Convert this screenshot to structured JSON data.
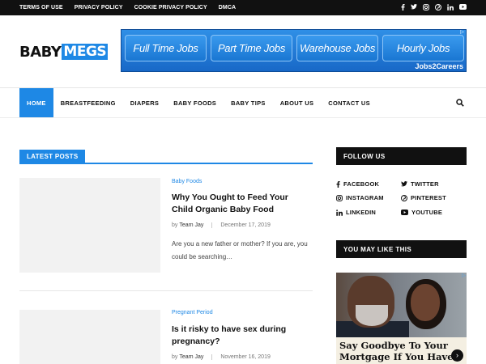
{
  "topbar": {
    "links": [
      "TERMS OF USE",
      "PRIVACY POLICY",
      "COOKIE PRIVACY POLICY",
      "DMCA"
    ],
    "social_icons": [
      "facebook-icon",
      "twitter-icon",
      "instagram-icon",
      "pinterest-icon",
      "linkedin-icon",
      "youtube-icon"
    ]
  },
  "logo": {
    "part1": "BABY",
    "part2": "MEGS"
  },
  "header_ad": {
    "buttons": [
      "Full Time Jobs",
      "Part Time Jobs",
      "Warehouse Jobs",
      "Hourly Jobs"
    ],
    "brand": "Jobs2Careers"
  },
  "nav": {
    "items": [
      "HOME",
      "BREASTFEEDING",
      "DIAPERS",
      "BABY FOODS",
      "BABY TIPS",
      "ABOUT US",
      "CONTACT US"
    ],
    "active": "HOME"
  },
  "latest": {
    "heading": "LATEST POSTS",
    "posts": [
      {
        "category": "Baby Foods",
        "title": "Why You Ought to Feed Your Child Organic Baby Food",
        "by": "by",
        "author": "Team Jay",
        "date": "December 17, 2019",
        "excerpt": "Are you a new father or mother? If you are, you could be searching…"
      },
      {
        "category": "Pregnant Period",
        "title": "Is it risky to have sex during pregnancy?",
        "by": "by",
        "author": "Team Jay",
        "date": "November 16, 2019"
      }
    ]
  },
  "sidebar": {
    "follow_title": "FOLLOW US",
    "follow": [
      {
        "label": "FACEBOOK",
        "icon": "facebook-icon"
      },
      {
        "label": "TWITTER",
        "icon": "twitter-icon"
      },
      {
        "label": "INSTAGRAM",
        "icon": "instagram-icon"
      },
      {
        "label": "PINTEREST",
        "icon": "pinterest-icon"
      },
      {
        "label": "LINKEDIN",
        "icon": "linkedin-icon"
      },
      {
        "label": "YOUTUBE",
        "icon": "youtube-icon"
      }
    ],
    "may_like_title": "YOU MAY LIKE THIS",
    "ad_caption": "Say Goodbye To Your Mortgage If You Have"
  },
  "colors": {
    "accent": "#1e88e5",
    "dark": "#111111"
  }
}
